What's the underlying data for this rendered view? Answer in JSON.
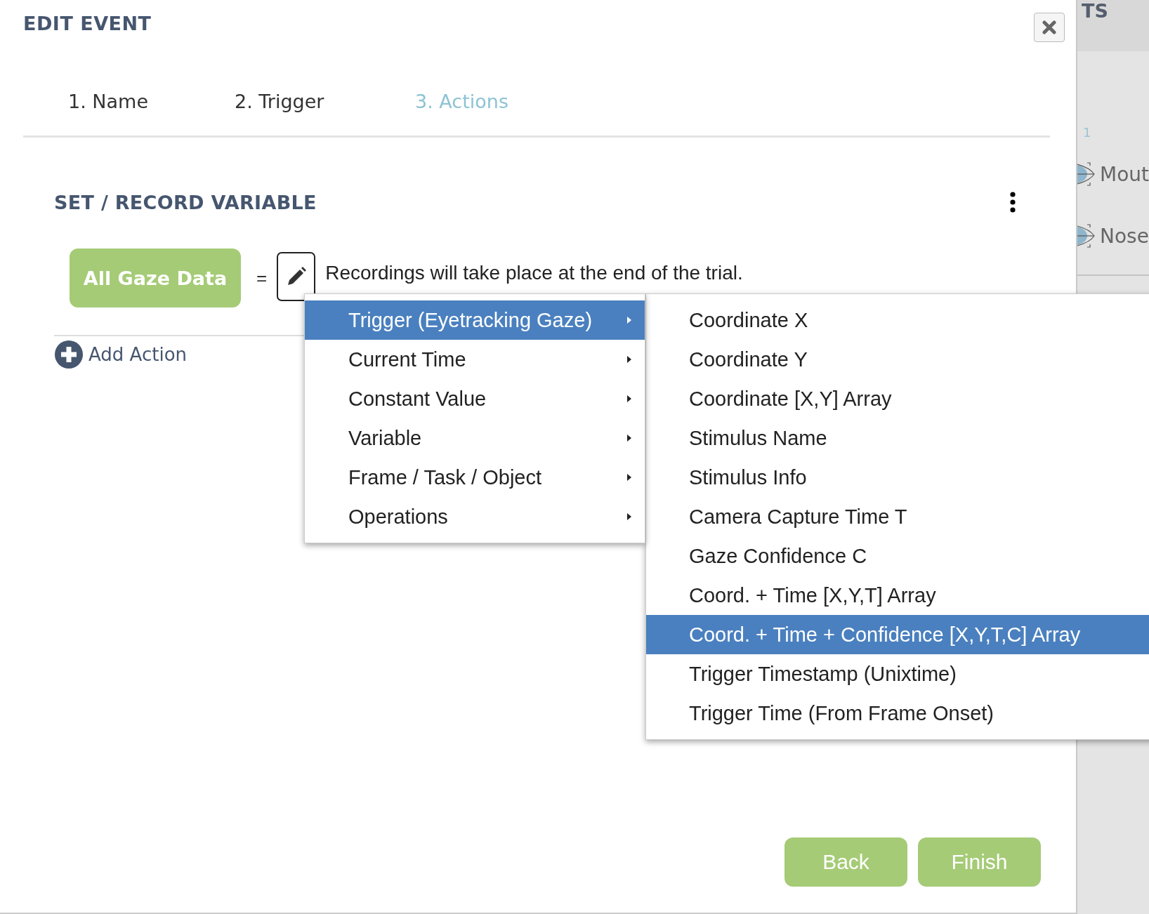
{
  "dialog": {
    "title": "EDIT EVENT"
  },
  "steps": [
    {
      "label": "1. Name",
      "selected": false
    },
    {
      "label": "2. Trigger",
      "selected": false
    },
    {
      "label": "3. Actions",
      "selected": true
    }
  ],
  "section": {
    "title": "SET / RECORD VARIABLE"
  },
  "action": {
    "variable": "All Gaze Data",
    "operator": "=",
    "note": "Recordings will take place at the end of the trial."
  },
  "add_action": "Add Action",
  "menu": {
    "items": [
      {
        "label": "Trigger (Eyetracking Gaze)",
        "selected": true,
        "has_submenu": true
      },
      {
        "label": "Current Time",
        "selected": false,
        "has_submenu": true
      },
      {
        "label": "Constant Value",
        "selected": false,
        "has_submenu": true
      },
      {
        "label": "Variable",
        "selected": false,
        "has_submenu": true
      },
      {
        "label": "Frame / Task / Object",
        "selected": false,
        "has_submenu": true
      },
      {
        "label": "Operations",
        "selected": false,
        "has_submenu": true
      }
    ]
  },
  "submenu": {
    "items": [
      {
        "label": "Coordinate X",
        "selected": false
      },
      {
        "label": "Coordinate Y",
        "selected": false
      },
      {
        "label": "Coordinate [X,Y] Array",
        "selected": false
      },
      {
        "label": "Stimulus Name",
        "selected": false
      },
      {
        "label": "Stimulus Info",
        "selected": false
      },
      {
        "label": "Camera Capture Time T",
        "selected": false
      },
      {
        "label": "Gaze Confidence C",
        "selected": false
      },
      {
        "label": "Coord. + Time [X,Y,T] Array",
        "selected": false
      },
      {
        "label": "Coord. + Time + Confidence [X,Y,T,C] Array",
        "selected": true
      },
      {
        "label": "Trigger Timestamp (Unixtime)",
        "selected": false
      },
      {
        "label": "Trigger Time (From Frame Onset)",
        "selected": false
      }
    ]
  },
  "buttons": [
    {
      "label": "Back"
    },
    {
      "label": "Finish"
    }
  ],
  "side_panel": {
    "heading": "TS",
    "count": "1",
    "items": [
      "Mout",
      "Nose"
    ]
  }
}
